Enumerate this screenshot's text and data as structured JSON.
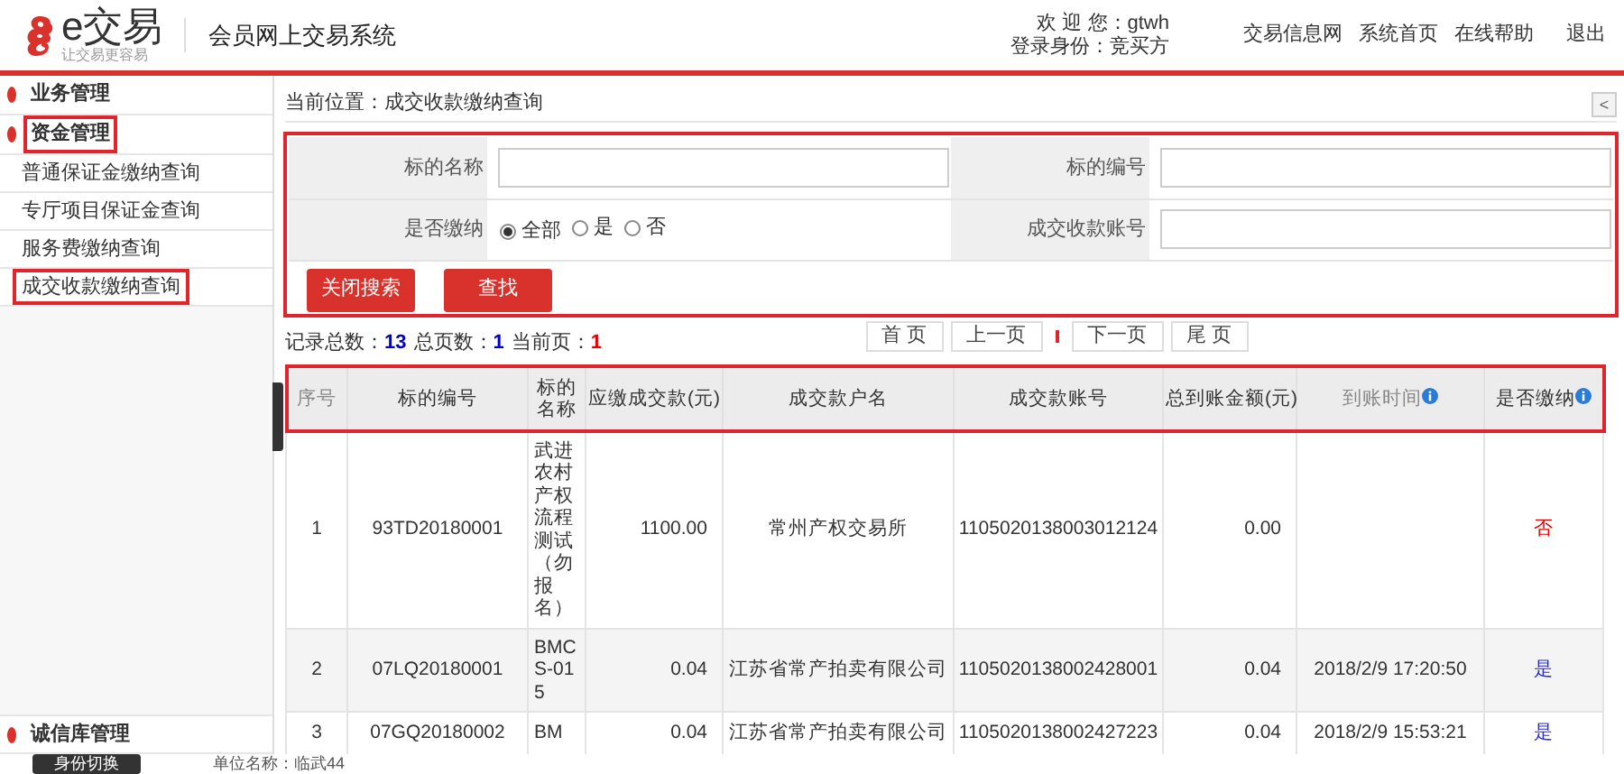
{
  "header": {
    "logo": {
      "name": "e交易",
      "slogan": "让交易更容易"
    },
    "system_title": "会员网上交易系统",
    "user": {
      "welcome": "欢 迎 您：gtwh",
      "role": "登录身份：竞买方"
    },
    "links": [
      "交易信息网",
      "系统首页",
      "在线帮助",
      "退出"
    ]
  },
  "sidebar": {
    "groups": [
      {
        "label": "业务管理",
        "highlighted": false
      },
      {
        "label": "资金管理",
        "highlighted": true,
        "children": [
          {
            "label": "普通保证金缴纳查询",
            "highlighted": false
          },
          {
            "label": "专厅项目保证金查询",
            "highlighted": false
          },
          {
            "label": "服务费缴纳查询",
            "highlighted": false
          },
          {
            "label": "成交收款缴纳查询",
            "highlighted": true
          }
        ]
      }
    ],
    "bottom_group": {
      "label": "诚信库管理"
    }
  },
  "breadcrumb": "当前位置：成交收款缴纳查询",
  "collapse_button": "<",
  "search": {
    "highlighted": true,
    "fields": [
      {
        "kind": "text",
        "label": "标的名称"
      },
      {
        "kind": "text",
        "label": "标的编号"
      },
      {
        "kind": "radio",
        "label": "是否缴纳",
        "options": [
          {
            "label": "全部",
            "selected": true
          },
          {
            "label": "是",
            "selected": false
          },
          {
            "label": "否",
            "selected": false
          }
        ]
      },
      {
        "kind": "text",
        "label": "成交收款账号"
      }
    ],
    "buttons": [
      "关闭搜索",
      "查找"
    ]
  },
  "summary": [
    {
      "label": "记录总数：",
      "value": "13",
      "color": "#0000cc"
    },
    {
      "label": "总页数：",
      "value": "1",
      "color": "#0000cc"
    },
    {
      "label": "当前页：",
      "value": "1",
      "color": "#e60000"
    }
  ],
  "pagination": [
    "首 页",
    "上一页",
    "下一页",
    "尾 页"
  ],
  "table": {
    "highlighted": true,
    "columns": [
      {
        "label": "序号",
        "info": false,
        "muted": true
      },
      {
        "label": "标的编号",
        "info": false,
        "muted": false
      },
      {
        "label": "标的名称",
        "info": false,
        "muted": false
      },
      {
        "label": "应缴成交款(元)",
        "info": false,
        "muted": false
      },
      {
        "label": "成交款户名",
        "info": false,
        "muted": false
      },
      {
        "label": "成交款账号",
        "info": false,
        "muted": false
      },
      {
        "label": "总到账金额(元)",
        "info": false,
        "muted": false
      },
      {
        "label": "到账时间",
        "info": true,
        "muted": true
      },
      {
        "label": "是否缴纳",
        "info": true,
        "muted": false
      }
    ],
    "rows": [
      {
        "cells": [
          "1",
          "93TD20180001",
          "武进农村产权流程测试（勿报名）",
          "1100.00",
          "常州产权交易所",
          "1105020138003012124",
          "0.00",
          ""
        ],
        "paid": false,
        "paid_text": "否"
      },
      {
        "cells": [
          "2",
          "07LQ20180001",
          "BMCS-015",
          "0.04",
          "江苏省常产拍卖有限公司",
          "1105020138002428001",
          "0.04",
          "2018/2/9 17:20:50"
        ],
        "paid": true,
        "paid_text": "是"
      },
      {
        "cells": [
          "3",
          "07GQ20180002",
          "BM",
          "0.04",
          "江苏省常产拍卖有限公司",
          "1105020138002427223",
          "0.04",
          "2018/2/9 15:53:21"
        ],
        "paid": true,
        "paid_text": "是"
      }
    ]
  },
  "bottom_bar": {
    "button": "身份切换",
    "org": "单位名称：临武44"
  }
}
